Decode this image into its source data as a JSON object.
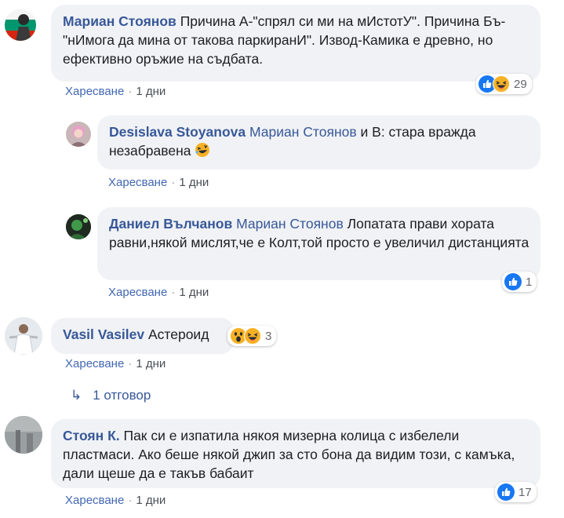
{
  "comments": [
    {
      "author": "Мариан Стоянов",
      "text": "Причина А-\"спрял си ми на мИстотУ\". Причина Бъ-\"нИмога да мина от такова паркиранИ\". Извод-Камика е древно, но ефективно оръжие на съдбата.",
      "like_label": "Харесване",
      "time": "1 дни",
      "reaction_count": "29"
    },
    {
      "author": "Desislava Stoyanova",
      "mention": "Мариан Стоянов",
      "text": " и В: стара вражда незабравена",
      "like_label": "Харесване",
      "time": "1 дни"
    },
    {
      "author": "Даниел Вълчанов",
      "mention": "Мариан Стоянов",
      "text": " Лопатата прави хората равни,някой мислят,че е Колт,той просто е увеличил дистанцията",
      "like_label": "Харесване",
      "time": "1 дни",
      "reaction_count": "1"
    },
    {
      "author": "Vasil Vasilev",
      "text": " Астероид",
      "like_label": "Харесване",
      "time": "1 дни",
      "reaction_count": "3",
      "replies_label": "1 отговор"
    },
    {
      "author": "Стоян К.",
      "text": " Пак си е изпатила някоя мизерна колица с избелели пластмаси. Ако беше някой джип за сто бона да видим този, с камъка, дали щеше да е такъв бабаит",
      "like_label": "Харесване",
      "time": "1 дни",
      "reaction_count": "17"
    }
  ],
  "colors": {
    "author": "#385898",
    "bubble": "#f0f2f5",
    "like_blue": "#1877f2",
    "haha_yellow": "#f7b125"
  },
  "icons": [
    "like-icon",
    "haha-icon",
    "wow-icon",
    "reply-arrow-icon",
    "rofl-emoji"
  ]
}
